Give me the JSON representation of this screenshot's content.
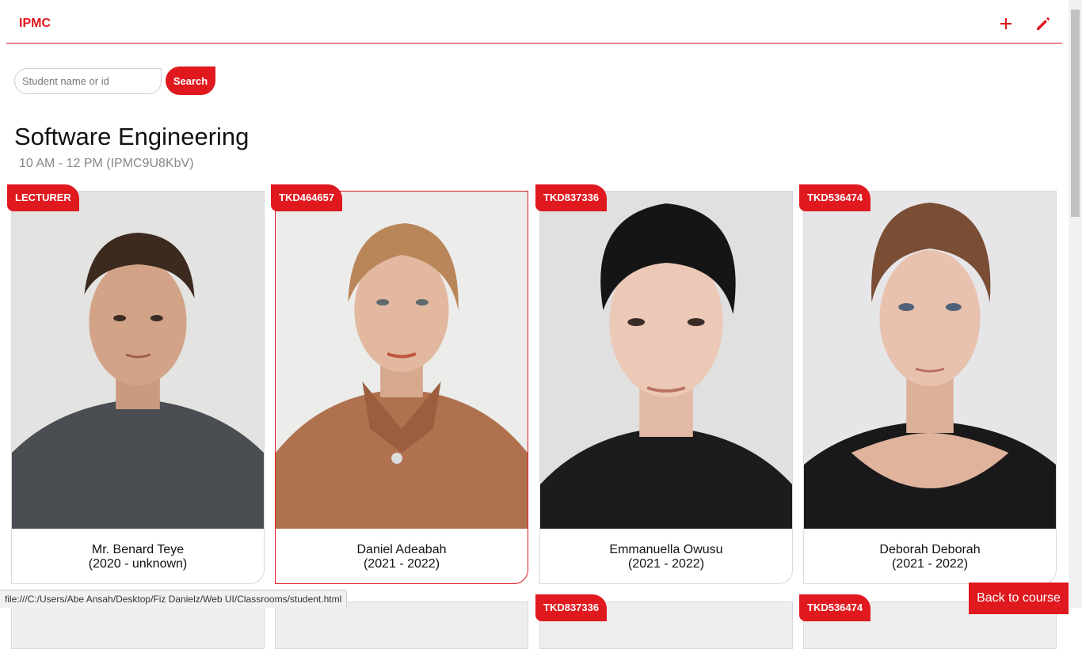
{
  "header": {
    "brand": "IPMC",
    "add_icon": "plus-icon",
    "edit_icon": "pencil-icon",
    "accent_color": "#e0191f"
  },
  "search": {
    "placeholder": "Student name or id",
    "value": "",
    "button_label": "Search"
  },
  "course": {
    "title": "Software Engineering",
    "subtitle": "10 AM - 12 PM (IPMC9U8KbV)"
  },
  "cards": [
    {
      "badge": "LECTURER",
      "name": "Mr. Benard Teye",
      "years": "(2020 - unknown)"
    },
    {
      "badge": "TKD464657",
      "name": "Daniel Adeabah",
      "years": "(2021 - 2022)"
    },
    {
      "badge": "TKD837336",
      "name": "Emmanuella Owusu",
      "years": "(2021 - 2022)"
    },
    {
      "badge": "TKD536474",
      "name": "Deborah Deborah",
      "years": "(2021 - 2022)"
    }
  ],
  "next_row_badges": [
    "TKD837336",
    "TKD536474"
  ],
  "status_bar": {
    "url": "file:///C:/Users/Abe Ansah/Desktop/Fiz Danielz/Web UI/Classrooms/student.html"
  },
  "footer": {
    "back_label": "Back to course"
  }
}
